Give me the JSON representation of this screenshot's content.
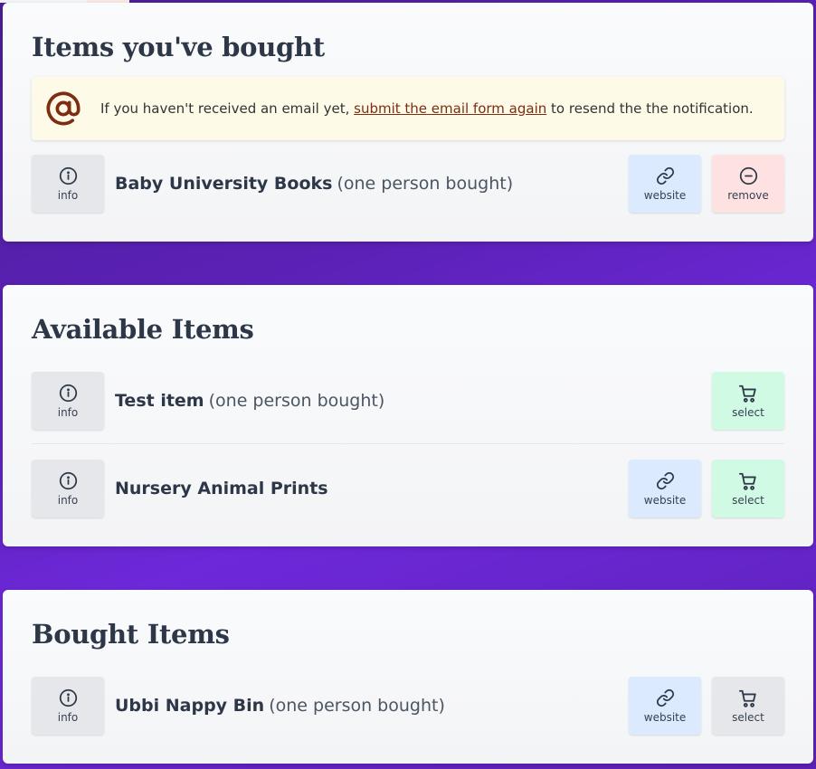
{
  "bought_section": {
    "title": "Items you've bought",
    "notice": {
      "icon": "at-sign-icon",
      "text_before": "If you haven't received an email yet,",
      "link_text": "submit the email form again",
      "text_after": "to resend the the notification."
    },
    "items": [
      {
        "name": "Baby University Books",
        "note": "(one person bought)",
        "info_label": "info",
        "website_label": "website",
        "remove_label": "remove"
      }
    ]
  },
  "available_section": {
    "title": "Available Items",
    "items": [
      {
        "name": "Test item",
        "note": "(one person bought)",
        "info_label": "info",
        "select_label": "select"
      },
      {
        "name": "Nursery Animal Prints",
        "info_label": "info",
        "website_label": "website",
        "select_label": "select"
      }
    ]
  },
  "bought_items_section": {
    "title": "Bought Items",
    "items": [
      {
        "name": "Ubbi Nappy Bin",
        "note": "(one person bought)",
        "info_label": "info",
        "website_label": "website",
        "select_label": "select"
      }
    ]
  },
  "colors": {
    "background": "#5b21b6",
    "card": "#f3f4f6",
    "info_button": "#e5e7eb",
    "website_button": "#dbeafe",
    "remove_button": "#fee2e2",
    "select_button_available": "#d1fae5",
    "select_button_disabled": "#e5e7eb",
    "notice_background": "#fefae8",
    "notice_icon": "#7c2d12"
  }
}
